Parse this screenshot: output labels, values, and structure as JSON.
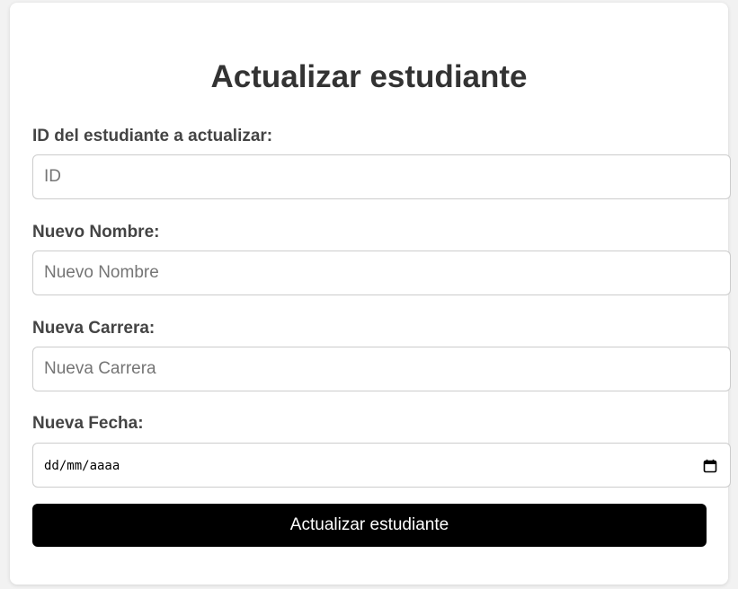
{
  "form": {
    "title": "Actualizar estudiante",
    "fields": [
      {
        "label": "ID del estudiante a actualizar:",
        "placeholder": "ID",
        "value": ""
      },
      {
        "label": "Nuevo Nombre:",
        "placeholder": "Nuevo Nombre",
        "value": ""
      },
      {
        "label": "Nueva Carrera:",
        "placeholder": "Nueva Carrera",
        "value": ""
      },
      {
        "label": "Nueva Fecha:",
        "placeholder": "dd/mm/aaaa",
        "value": ""
      }
    ],
    "submit_label": "Actualizar estudiante"
  },
  "colors": {
    "button_background": "#000000",
    "button_text": "#ffffff",
    "title_text": "#333333",
    "label_text": "#444444",
    "page_background": "#f2f2f2"
  },
  "icons": {
    "date_picker": "calendar-icon"
  }
}
